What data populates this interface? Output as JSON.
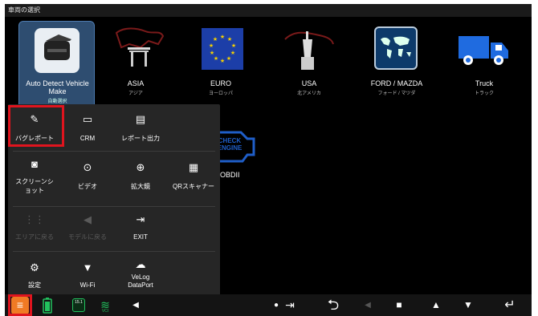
{
  "window": {
    "title": "車両の選択"
  },
  "tiles": [
    {
      "name": "Auto Detect Vehicle Make",
      "sub": "自動選択"
    },
    {
      "name": "ASIA",
      "sub": "アジア"
    },
    {
      "name": "EURO",
      "sub": "ヨーロッパ"
    },
    {
      "name": "USA",
      "sub": "北アメリカ"
    },
    {
      "name": "FORD / MAZDA",
      "sub": "フォード / マツダ"
    },
    {
      "name": "Truck",
      "sub": "トラック"
    },
    {
      "name": "OBDII",
      "sub": ""
    }
  ],
  "obd_badge": "CHECK ENGINE",
  "menu": {
    "items": [
      {
        "label": "バグレポート",
        "icon": "bug-report-icon"
      },
      {
        "label": "CRM",
        "icon": "clipboard-icon"
      },
      {
        "label": "レポート出力",
        "icon": "report-export-icon"
      },
      {
        "label": "スクリーンショット",
        "line1": "スクリーンシ",
        "line2": "ョット",
        "icon": "screenshot-icon"
      },
      {
        "label": "ビデオ",
        "icon": "video-record-icon"
      },
      {
        "label": "拡大鏡",
        "icon": "magnifier-icon"
      },
      {
        "label": "QRスキャナー",
        "icon": "qr-code-icon"
      },
      {
        "label": "エリアに戻る",
        "icon": "grid-icon"
      },
      {
        "label": "モデルに戻る",
        "icon": "back-arrow-icon"
      },
      {
        "label": "EXIT",
        "icon": "exit-icon"
      },
      {
        "label": "設定",
        "icon": "gear-icon"
      },
      {
        "label": "Wi-Fi",
        "icon": "wifi-icon"
      },
      {
        "label": "VeLog DataPort",
        "line1": "VeLog",
        "line2": "DataPort",
        "icon": "cloud-upload-icon"
      }
    ]
  },
  "taskbar": {
    "battery_text": "15.1",
    "vci_text": "VCI",
    "colors": {
      "menu": "#f07a24",
      "status": "#22c35e",
      "highlight": "#e0141e",
      "selected_tile": "#2e4d70"
    }
  }
}
